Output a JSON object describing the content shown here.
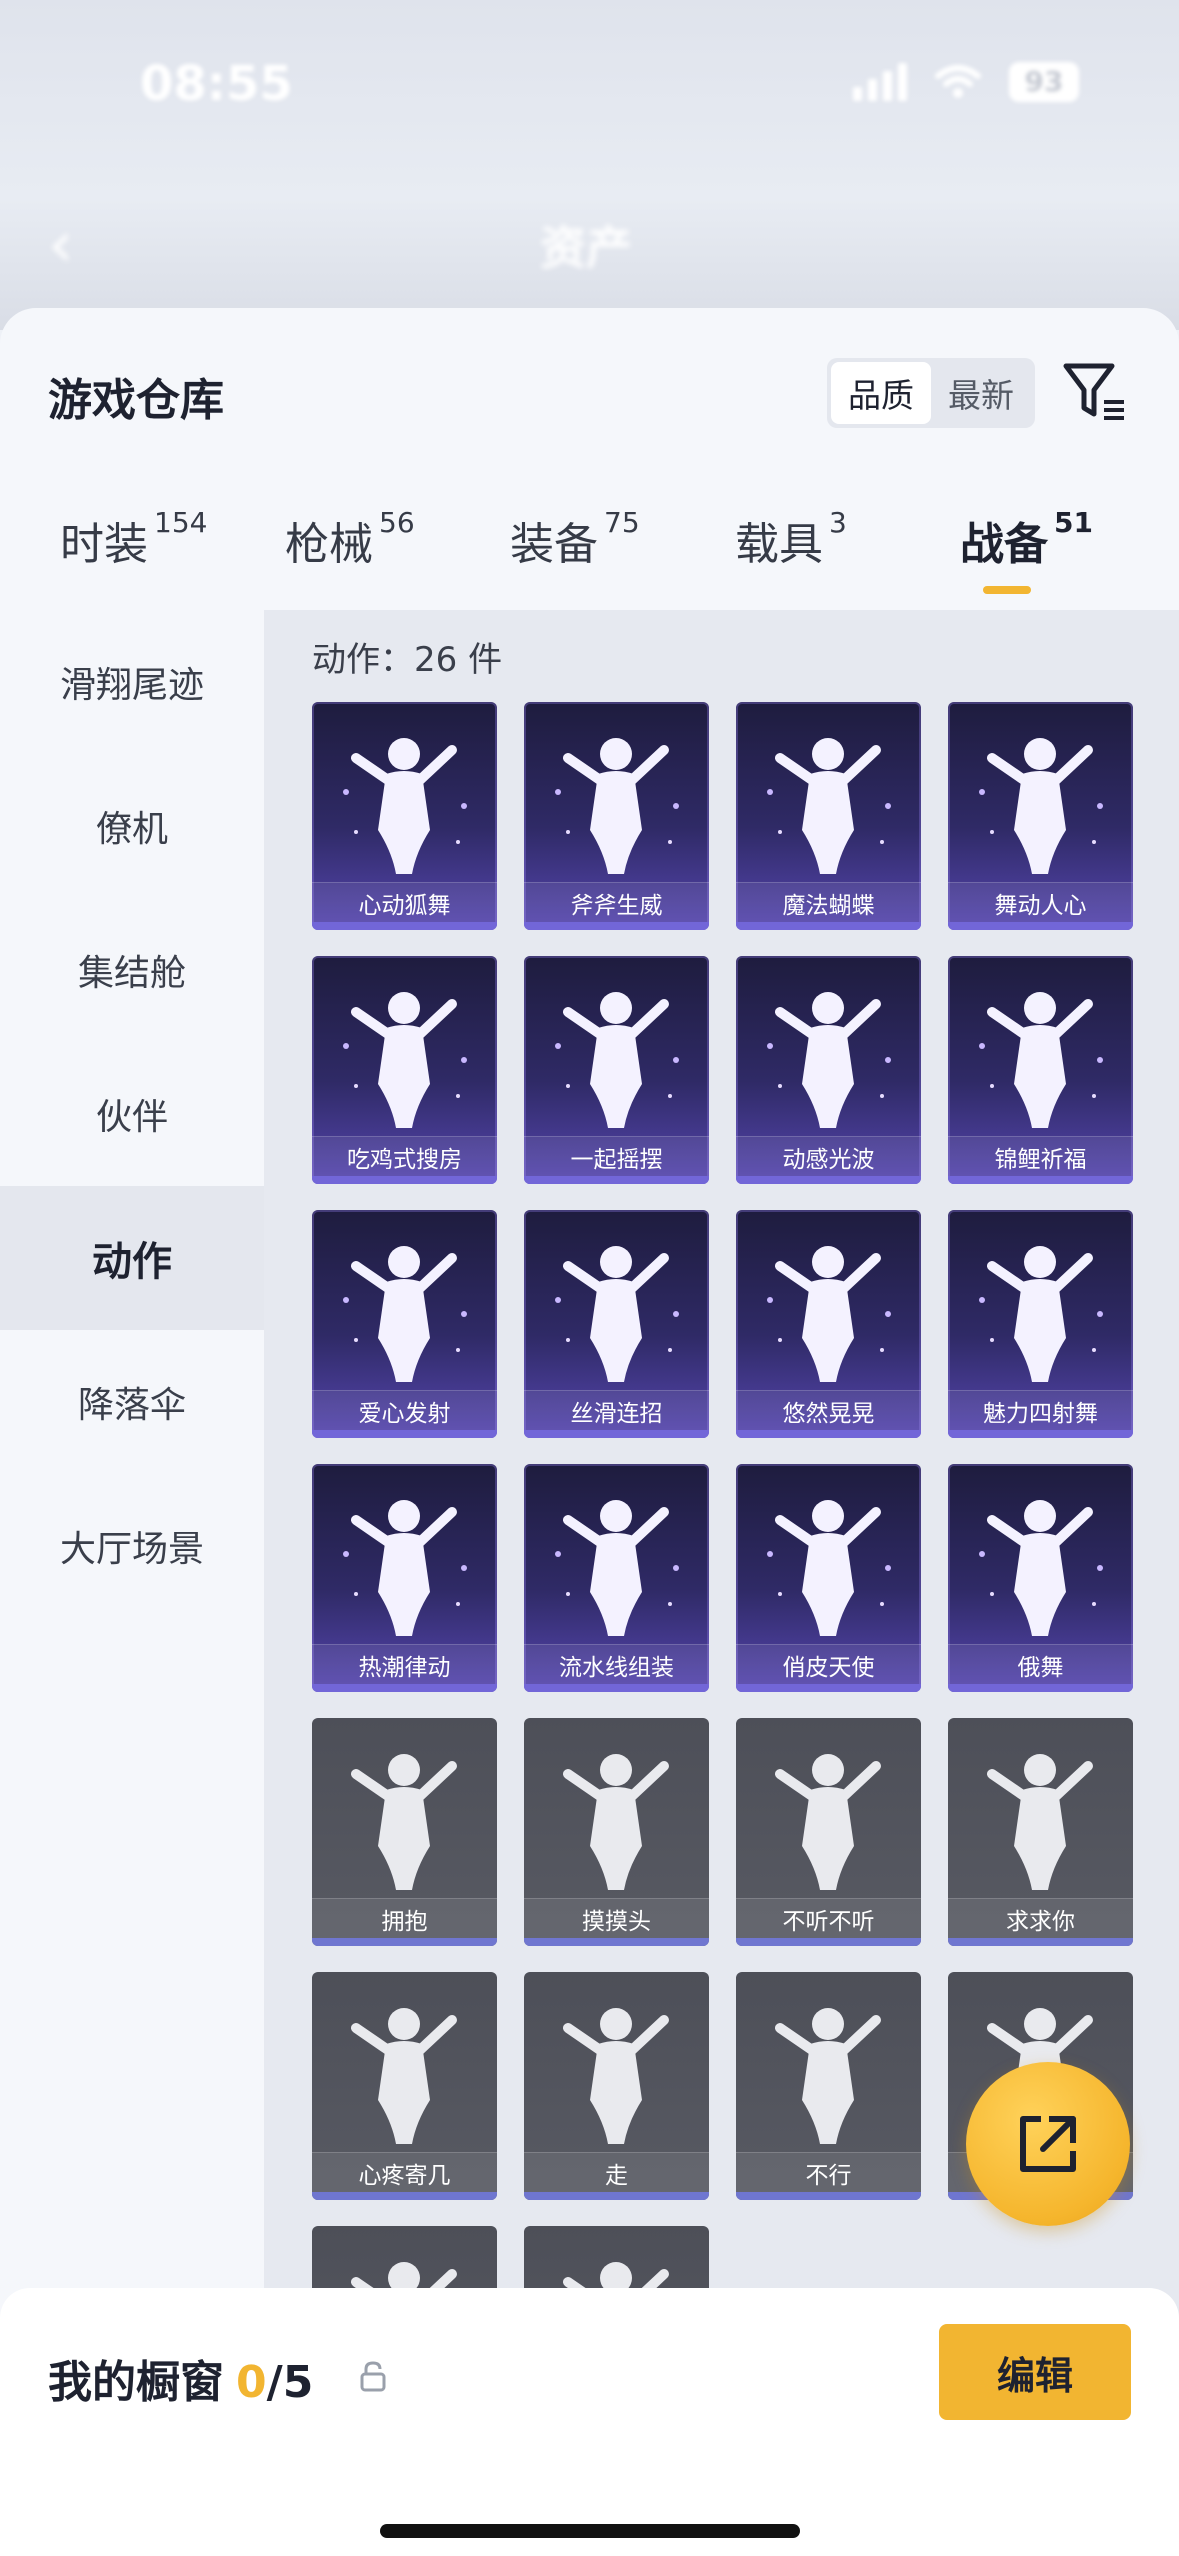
{
  "status": {
    "time": "08:55",
    "battery": "93"
  },
  "header": {
    "back": "‹",
    "title": "资产"
  },
  "sheet": {
    "title": "游戏仓库",
    "sort": [
      "品质",
      "最新"
    ],
    "tabs": [
      {
        "label": "时装",
        "count": "154"
      },
      {
        "label": "枪械",
        "count": "56"
      },
      {
        "label": "装备",
        "count": "75"
      },
      {
        "label": "载具",
        "count": "3"
      },
      {
        "label": "战备",
        "count": "51"
      }
    ]
  },
  "sidebar": {
    "items": [
      "滑翔尾迹",
      "僚机",
      "集结舱",
      "伙伴",
      "动作",
      "降落伞",
      "大厅场景"
    ]
  },
  "content": {
    "count_label": "动作：26 件",
    "cards": [
      {
        "label": "心动狐舞",
        "tier": "purple"
      },
      {
        "label": "斧斧生威",
        "tier": "purple"
      },
      {
        "label": "魔法蝴蝶",
        "tier": "purple"
      },
      {
        "label": "舞动人心",
        "tier": "purple"
      },
      {
        "label": "吃鸡式搜房",
        "tier": "purple"
      },
      {
        "label": "一起摇摆",
        "tier": "purple"
      },
      {
        "label": "动感光波",
        "tier": "purple"
      },
      {
        "label": "锦鲤祈福",
        "tier": "purple"
      },
      {
        "label": "爱心发射",
        "tier": "purple"
      },
      {
        "label": "丝滑连招",
        "tier": "purple"
      },
      {
        "label": "悠然晃晃",
        "tier": "purple"
      },
      {
        "label": "魅力四射舞",
        "tier": "purple"
      },
      {
        "label": "热潮律动",
        "tier": "purple"
      },
      {
        "label": "流水线组装",
        "tier": "purple"
      },
      {
        "label": "俏皮天使",
        "tier": "purple"
      },
      {
        "label": "俄舞",
        "tier": "purple"
      },
      {
        "label": "拥抱",
        "tier": "gray"
      },
      {
        "label": "摸摸头",
        "tier": "gray"
      },
      {
        "label": "不听不听",
        "tier": "gray"
      },
      {
        "label": "求求你",
        "tier": "gray"
      },
      {
        "label": "心疼寄几",
        "tier": "gray"
      },
      {
        "label": "走",
        "tier": "gray"
      },
      {
        "label": "不行",
        "tier": "gray"
      },
      {
        "label": "",
        "tier": "gray"
      },
      {
        "label": "",
        "tier": "gray"
      },
      {
        "label": "",
        "tier": "gray"
      }
    ]
  },
  "showcase": {
    "title": "我的橱窗",
    "current": "0",
    "total": "/5",
    "edit_label": "编辑"
  },
  "colors": {
    "accent": "#f2b531",
    "card_purple": "#2f2a66",
    "card_gray": "#585a63"
  }
}
